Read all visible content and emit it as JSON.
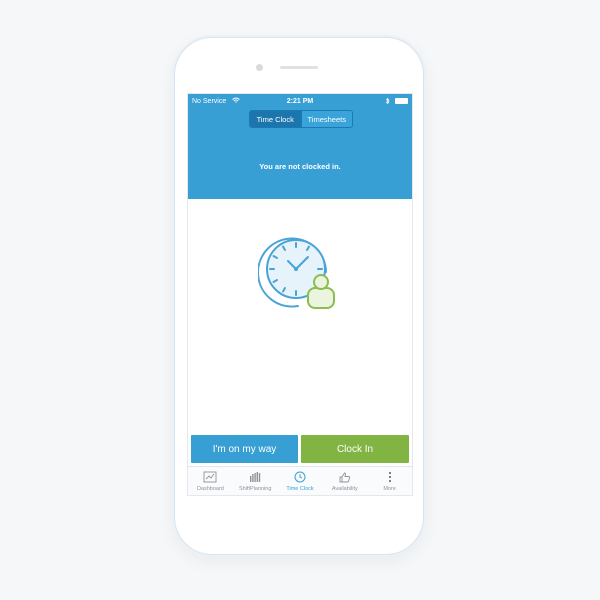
{
  "status_bar": {
    "carrier": "No Service",
    "time": "2:21 PM"
  },
  "segmented": {
    "tabs": [
      {
        "label": "Time Clock",
        "active": true
      },
      {
        "label": "Timesheets",
        "active": false
      }
    ]
  },
  "header": {
    "message": "You are not clocked in."
  },
  "actions": {
    "on_my_way_label": "I'm on my way",
    "clock_in_label": "Clock In"
  },
  "tab_bar": {
    "items": [
      {
        "label": "Dashboard",
        "icon": "chart-icon",
        "active": false
      },
      {
        "label": "ShiftPlanning",
        "icon": "schedule-grid-icon",
        "active": false
      },
      {
        "label": "Time Clock",
        "icon": "clock-icon",
        "active": true
      },
      {
        "label": "Availability",
        "icon": "thumbs-up-icon",
        "active": false
      },
      {
        "label": "More",
        "icon": "more-vertical-icon",
        "active": false
      }
    ]
  },
  "colors": {
    "header_blue": "#389fd4",
    "segment_active": "#1c76ad",
    "clock_in_green": "#82b444",
    "illustration_blue": "#4aa3d6",
    "illustration_green": "#8bbd4f",
    "tab_inactive": "#8c949b"
  }
}
